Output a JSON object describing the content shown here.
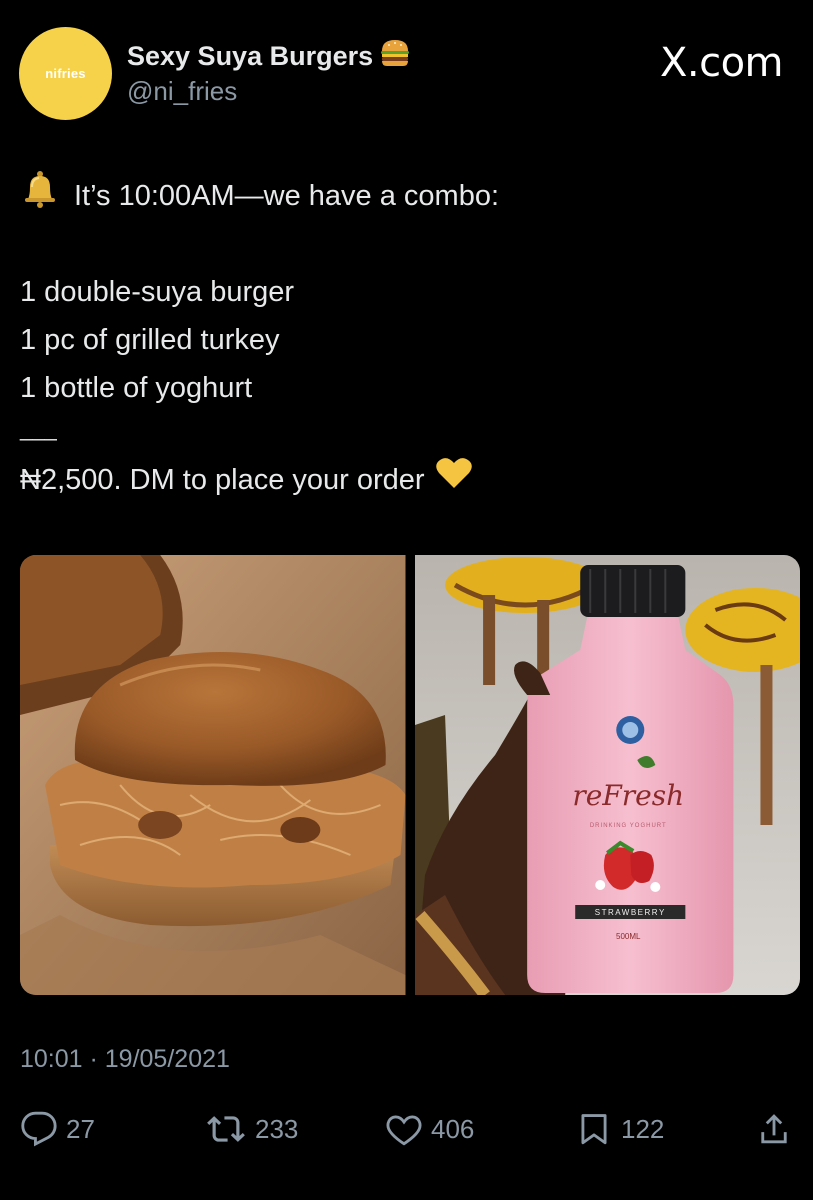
{
  "author": {
    "avatar_text": "nifries",
    "display_name": "Sexy Suya Burgers",
    "name_emoji": "burger-emoji-icon",
    "handle": "@ni_fries"
  },
  "brand": "X.com",
  "tweet": {
    "bell_icon": "bell-emoji-icon",
    "line1": "It’s 10:00AM—we have a combo:",
    "item1": "1 double-suya burger",
    "item2": "1 pc of grilled turkey",
    "item3": "1 bottle of yoghurt",
    "divider": "___",
    "price_line": "₦2,500. DM to place your order",
    "heart_icon": "yellow-heart-emoji-icon"
  },
  "media": {
    "image1": "suya-burger-photo",
    "image2": {
      "subject": "yoghurt-bottle-photo",
      "brand": "reFresh",
      "tagline": "DRINKING YOGHURT",
      "flavor": "STRAWBERRY",
      "volume": "500ML"
    }
  },
  "timestamp": "10:01 · 19/05/2021",
  "actions": {
    "replies": "27",
    "reposts": "233",
    "likes": "406",
    "bookmarks": "122"
  },
  "colors": {
    "background": "#000000",
    "text": "#e7e9ea",
    "secondary": "#8b98a5",
    "avatar": "#f6d24a",
    "yoghurt_pink": "#f4b6c7"
  }
}
